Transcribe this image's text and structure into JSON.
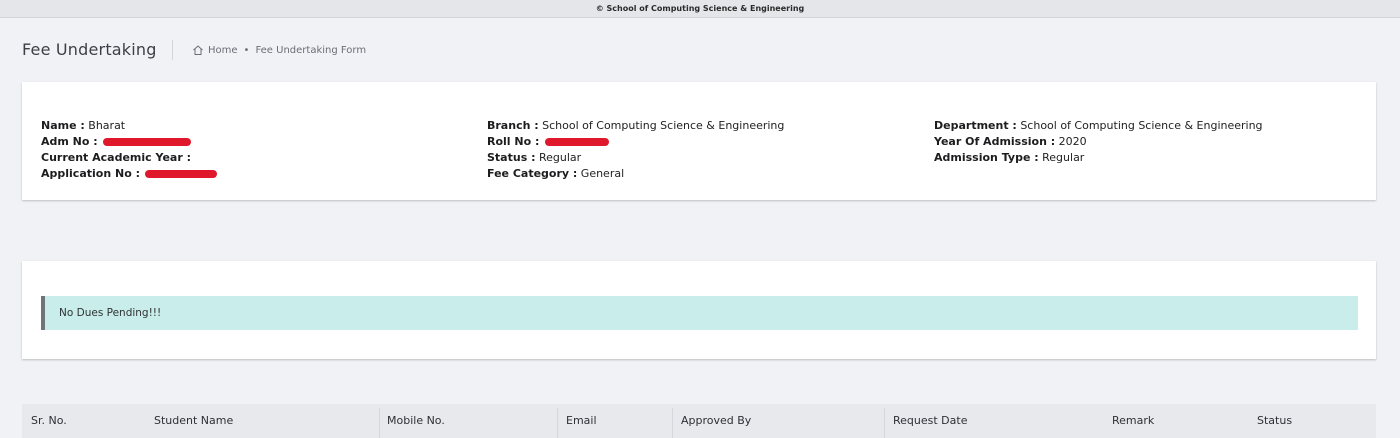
{
  "window": {
    "title": "© School of Computing Science & Engineering"
  },
  "header": {
    "title": "Fee Undertaking",
    "breadcrumb": {
      "home": "Home",
      "current": "Fee Undertaking Form"
    }
  },
  "student": {
    "name_label": "Name :",
    "name_value": "Bharat",
    "adm_label": "Adm No :",
    "academic_year_label": "Current Academic Year :",
    "application_label": "Application No :",
    "branch_label": "Branch :",
    "branch_value": "School of Computing Science & Engineering",
    "roll_label": "Roll No :",
    "status_label": "Status :",
    "status_value": "Regular",
    "fee_category_label": "Fee Category :",
    "fee_category_value": "General",
    "department_label": "Department :",
    "department_value": "School of Computing Science & Engineering",
    "year_label": "Year Of Admission :",
    "year_value": "2020",
    "admission_type_label": "Admission Type :",
    "admission_type_value": "Regular"
  },
  "dues": {
    "message": "No Dues Pending!!!"
  },
  "table": {
    "columns": [
      "Sr. No.",
      "Student Name",
      "Mobile No.",
      "Email",
      "Approved By",
      "Request Date",
      "Remark",
      "Status"
    ]
  },
  "colors": {
    "alert_bg": "#c9edea",
    "redaction": "#e0182c",
    "page_bg": "#f1f2f6"
  }
}
